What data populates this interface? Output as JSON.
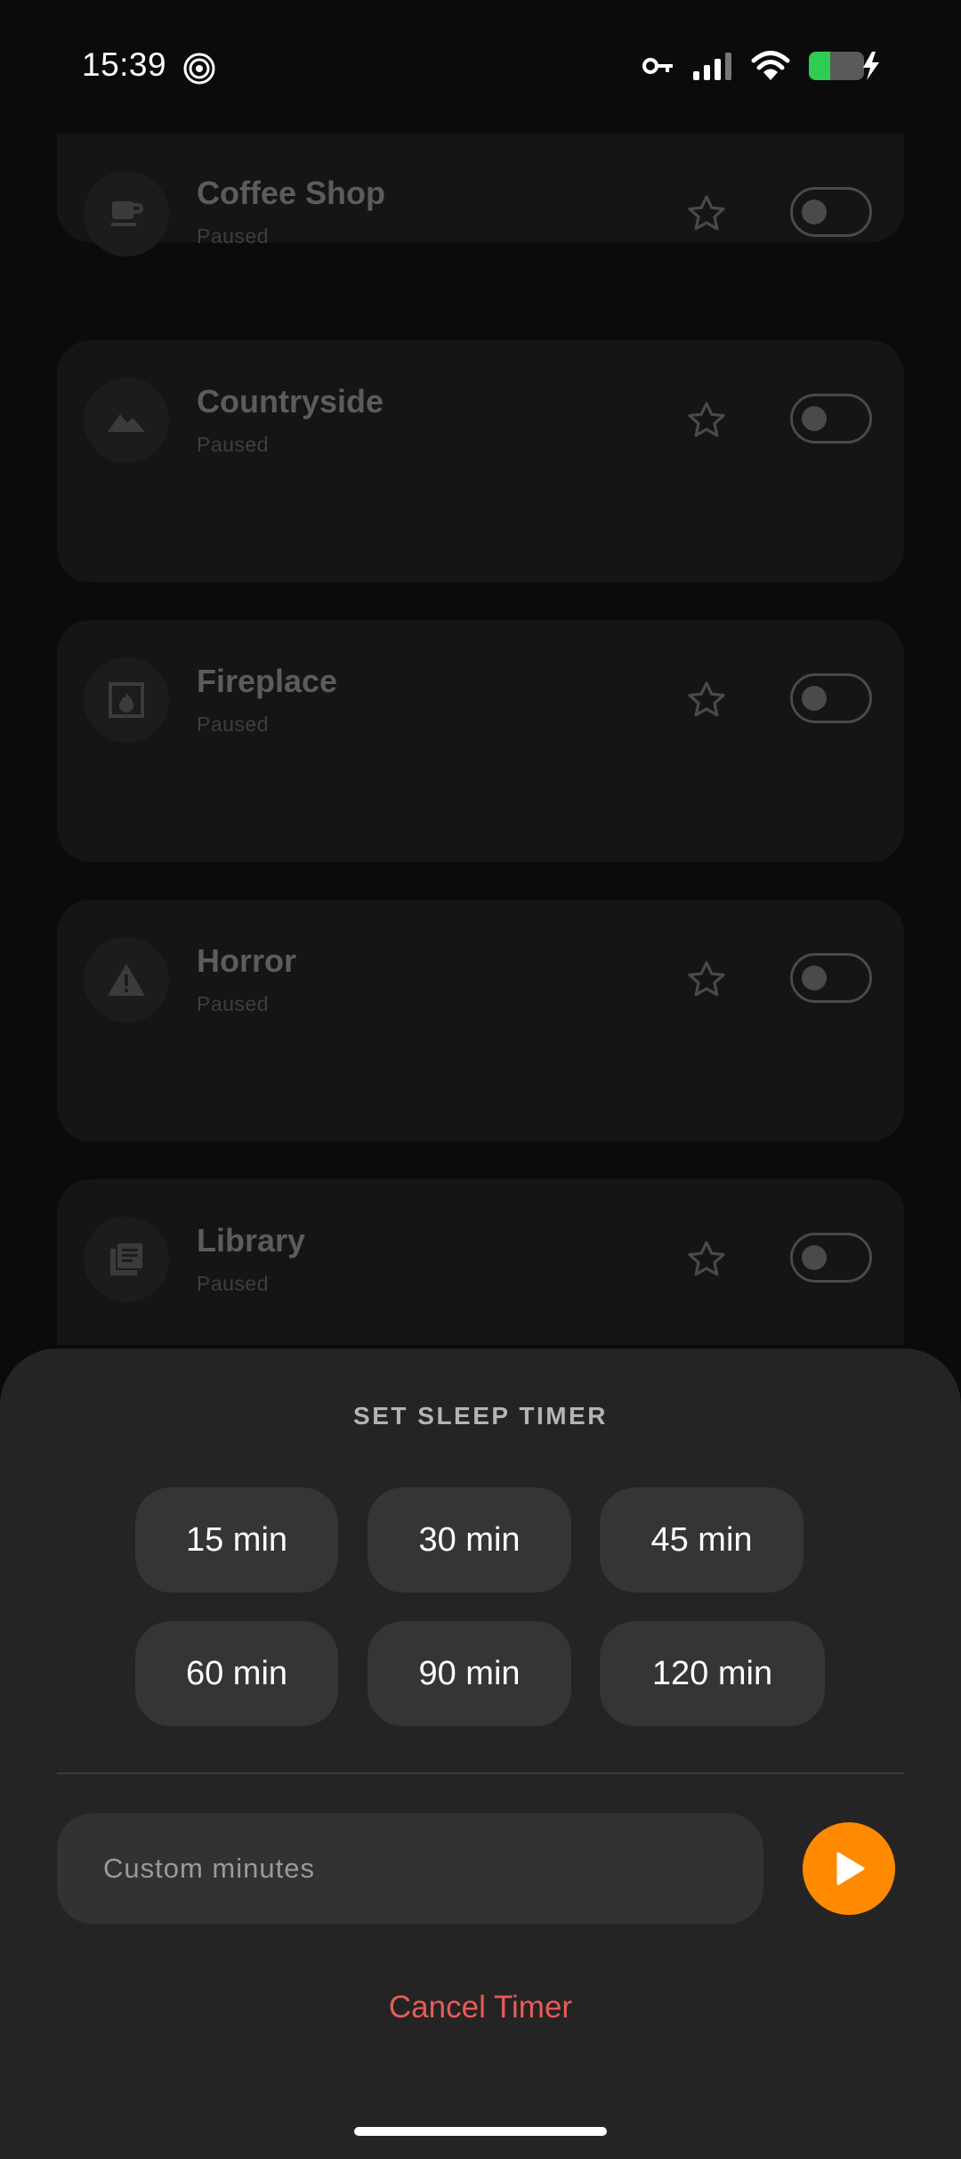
{
  "status_bar": {
    "time": "15:39",
    "icons": [
      "spiral-notification-icon",
      "vpn-key-icon",
      "cell-signal-icon",
      "wifi-icon",
      "battery-charging-icon"
    ],
    "battery_color": "#2ecc52"
  },
  "sounds": [
    {
      "name": "Coffee Shop",
      "status": "Paused",
      "icon": "coffee-cup-icon"
    },
    {
      "name": "Countryside",
      "status": "Paused",
      "icon": "mountains-icon"
    },
    {
      "name": "Fireplace",
      "status": "Paused",
      "icon": "fireplace-icon"
    },
    {
      "name": "Horror",
      "status": "Paused",
      "icon": "warning-triangle-icon"
    },
    {
      "name": "Library",
      "status": "Paused",
      "icon": "library-books-icon"
    }
  ],
  "sleep_timer": {
    "title": "SET SLEEP TIMER",
    "presets": [
      "15 min",
      "30 min",
      "45 min",
      "60 min",
      "90 min",
      "120 min"
    ],
    "custom_placeholder": "Custom minutes",
    "custom_value": "",
    "cancel_label": "Cancel Timer",
    "accent_color": "#ff8a00",
    "cancel_color": "#e95b57"
  }
}
